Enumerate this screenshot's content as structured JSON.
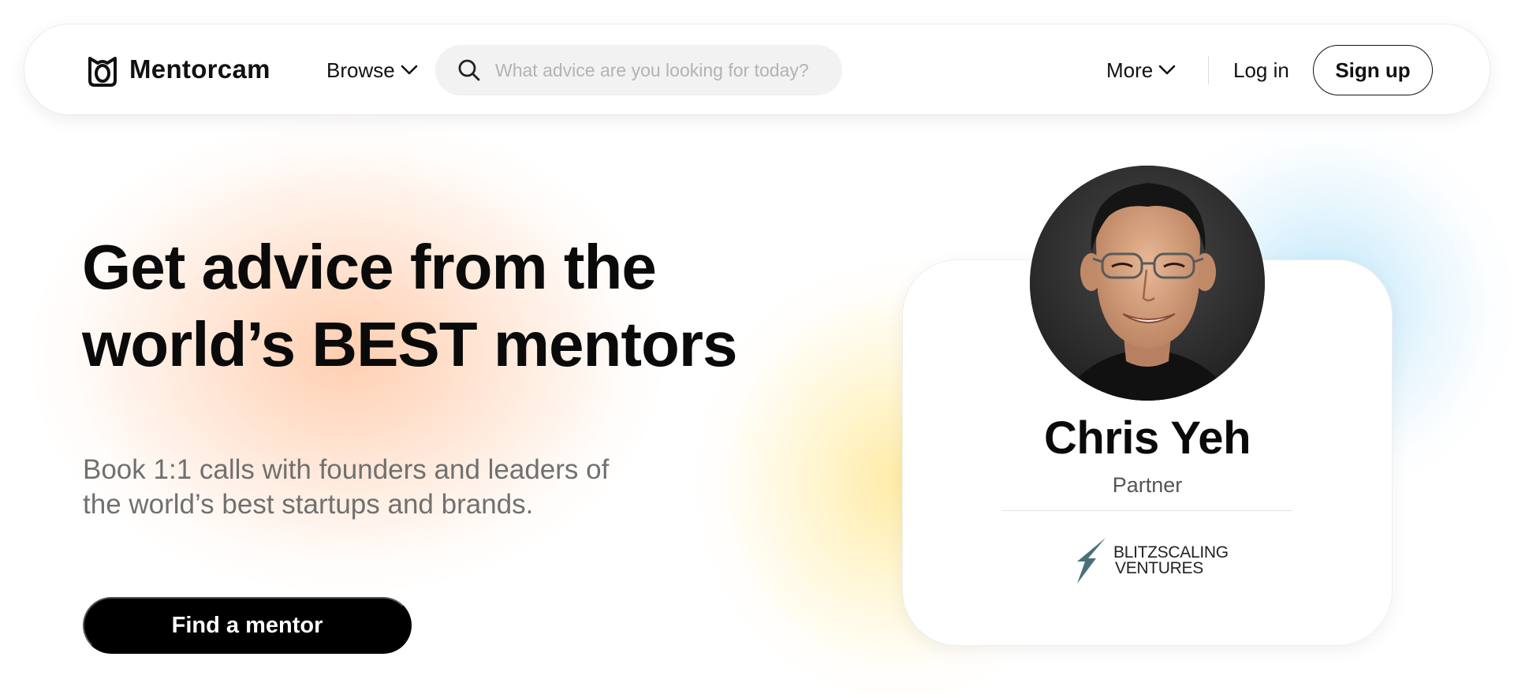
{
  "brand": {
    "name": "Mentorcam",
    "icon": "mentorcam-logo-icon"
  },
  "nav": {
    "browse_label": "Browse",
    "search_placeholder": "What advice are you looking for today?",
    "search_value": "",
    "more_label": "More",
    "login_label": "Log in",
    "signup_label": "Sign up"
  },
  "hero": {
    "title_line1": "Get advice from the",
    "title_line2": "world’s BEST mentors",
    "subtitle_line1": "Book 1:1 calls with founders and leaders of",
    "subtitle_line2": "the world’s best startups and brands.",
    "cta_label": "Find a mentor"
  },
  "mentor_card": {
    "name": "Chris Yeh",
    "role": "Partner",
    "company_line1": "BLITZSCALING",
    "company_line2": "VENTURES"
  },
  "colors": {
    "primary": "#000000",
    "muted_text": "#707070",
    "peach_glow": "#ffbe96",
    "yellow_glow": "#ffe482",
    "blue_glow": "#a0dcfa",
    "company_mark": "#4a6f78"
  }
}
